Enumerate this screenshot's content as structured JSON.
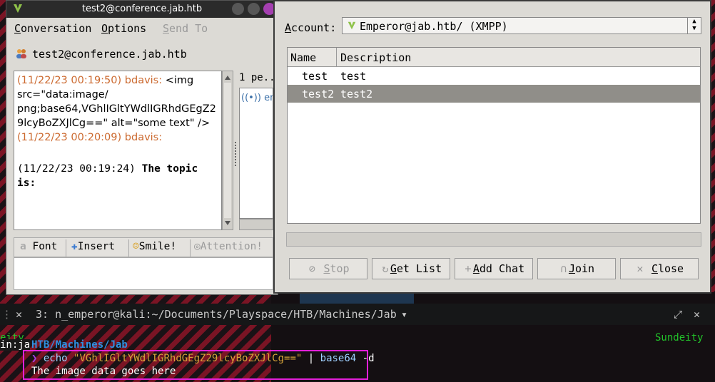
{
  "conversation_window": {
    "title": "test2@conference.jab.htb",
    "menu": [
      "Conversation",
      "Options",
      "Send To"
    ],
    "header": "test2@conference.jab.htb",
    "messages": [
      {
        "time": "(11/22/23 00:19:50)",
        "sender": "bdavis:",
        "line1": "<img",
        "line2": "src=\"data:image/",
        "line3": "png;base64,VGhlIGltYWdlIGRhdGEgZ2",
        "line4": "9lcyBoZXJlCg==\" alt=\"some text\" />"
      },
      {
        "time": "(11/22/23 00:20:09)",
        "sender": "bdavis:"
      },
      {
        "time": "(11/22/23 00:19:24)",
        "bold_line1": "The topic",
        "bold_line2": "is:"
      }
    ],
    "people_count": "1 pe...",
    "people": [
      "ema"
    ],
    "format_toolbar": {
      "font": "Font",
      "insert": "Insert",
      "smile": "Smile!",
      "attention": "Attention!"
    }
  },
  "room_list_window": {
    "account_label": "Account:",
    "account_value": "Emperor@jab.htb/ (XMPP)",
    "columns": {
      "name": "Name",
      "description": "Description"
    },
    "rooms": [
      {
        "name": "test",
        "description": "test"
      },
      {
        "name": "test2",
        "description": "test2"
      }
    ],
    "buttons": {
      "stop": "Stop",
      "get_list": "Get List",
      "add_chat": "Add Chat",
      "join": "Join",
      "close": "Close"
    }
  },
  "terminal": {
    "tab_title": "3: n_emperor@kali:~/Documents/Playspace/HTB/Machines/Jab",
    "left_fragment_1": "eity",
    "left_fragment_2": "in:ja",
    "path": "HTB/Machines/Jab",
    "right_label": "Sundeity",
    "prompt_symbol": "❯",
    "command": "echo",
    "argument": "\"VGhlIGltYWdlIGRhdGEgZ29lcyBoZXJlCg==\"",
    "pipe": "|",
    "pipe_cmd": "base64",
    "flag": "-d",
    "output": "The image data goes here"
  },
  "colors": {
    "timestamp": "#cc6a30",
    "selected_row": "#908e89",
    "highlight_box": "#e21fd8",
    "prompt_green": "#22c22a",
    "path_blue": "#2f8fe0",
    "string_orange": "#d8a43a"
  }
}
